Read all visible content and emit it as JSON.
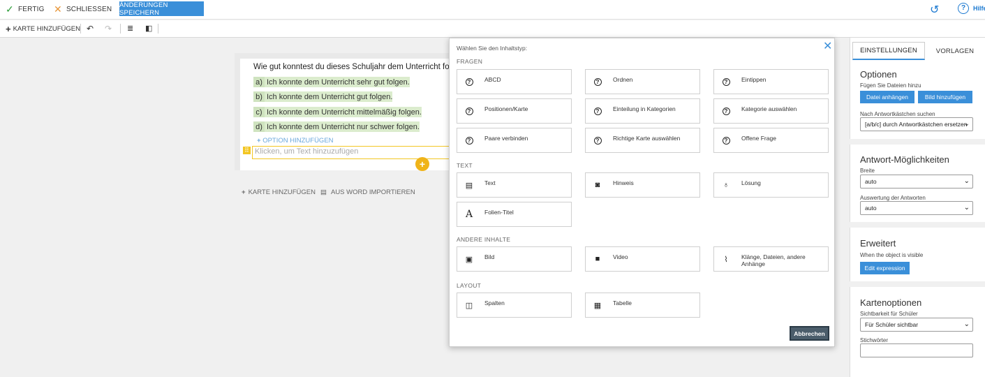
{
  "topbar": {
    "done_label": "FERTIG",
    "close_label": "SCHLIESSEN",
    "save_label": "ÄNDERUNGEN SPEICHERN",
    "help_label": "Hilfe"
  },
  "toolbar": {
    "add_card_label": "KARTE HINZUFÜGEN"
  },
  "card": {
    "question": "Wie gut konntest du dieses Schuljahr dem Unterricht folgen?",
    "options": [
      {
        "letter": "a)",
        "text": "Ich konnte dem Unterricht sehr gut folgen."
      },
      {
        "letter": "b)",
        "text": "Ich konnte dem Unterricht gut folgen."
      },
      {
        "letter": "c)",
        "text": "Ich konnte dem Unterricht mittelmäßig folgen."
      },
      {
        "letter": "d)",
        "text": "Ich konnte dem Unterricht nur schwer folgen."
      }
    ],
    "add_option_label": "OPTION HINZUFÜGEN",
    "text_placeholder": "Klicken, um Text hinzuzufügen"
  },
  "below_card": {
    "add_card_label": "KARTE HINZUFÜGEN",
    "import_label": "AUS WORD IMPORTIEREN"
  },
  "modal": {
    "title": "Wählen Sie den Inhaltstyp:",
    "sections": [
      {
        "heading": "FRAGEN",
        "tiles": [
          "ABCD",
          "Ordnen",
          "Eintippen",
          "Positionen/Karte",
          "Einteilung in Kategorien",
          "Kategorie auswählen",
          "Paare verbinden",
          "Richtige Karte auswählen",
          "Offene Frage"
        ]
      },
      {
        "heading": "TEXT",
        "tiles": [
          "Text",
          "Hinweis",
          "Lösung",
          "Folien-Titel"
        ]
      },
      {
        "heading": "ANDERE INHALTE",
        "tiles": [
          "Bild",
          "Video",
          "Klänge, Dateien, andere Anhänge"
        ]
      },
      {
        "heading": "LAYOUT",
        "tiles": [
          "Spalten",
          "Tabelle"
        ]
      }
    ],
    "cancel_label": "Abbrechen"
  },
  "panel": {
    "tabs": [
      "EINSTELLUNGEN",
      "VORLAGEN"
    ],
    "options": {
      "heading": "Optionen",
      "sub": "Fügen Sie Dateien hinzu",
      "attach_file_label": "Datei anhängen",
      "add_image_label": "Bild hinzufügen",
      "search_label": "Nach Antwortkästchen suchen",
      "search_value": "[a/b/c] durch Antwortkästchen ersetzen"
    },
    "answers": {
      "heading": "Antwort-Möglichkeiten",
      "width_label": "Breite",
      "width_value": "auto",
      "eval_label": "Auswertung der Antworten",
      "eval_value": "auto"
    },
    "advanced": {
      "heading": "Erweitert",
      "sub": "When the object is visible",
      "edit_label": "Edit expression"
    },
    "card_options": {
      "heading": "Kartenoptionen",
      "visibility_label": "Sichtbarkeit für Schüler",
      "visibility_value": "Für Schüler sichtbar",
      "keywords_label": "Stichwörter",
      "keywords_value": ""
    }
  },
  "colors": {
    "accent": "#3a8fd9",
    "highlight": "#f3c623",
    "option_bg": "#dbeccd"
  }
}
